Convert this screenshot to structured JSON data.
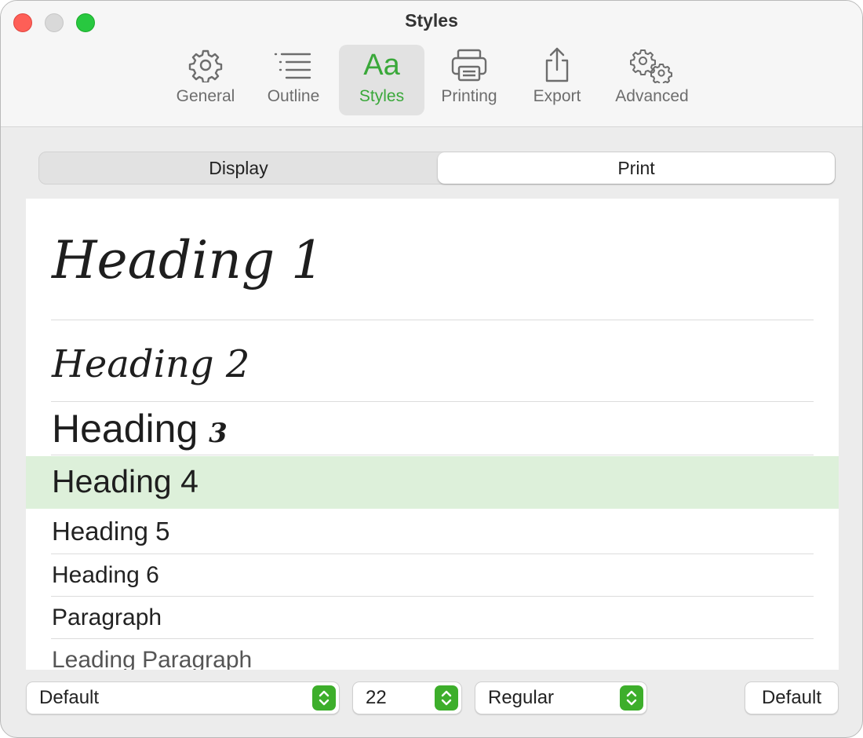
{
  "window": {
    "title": "Styles"
  },
  "toolbar": {
    "items": [
      {
        "label": "General",
        "icon": "gear-icon"
      },
      {
        "label": "Outline",
        "icon": "list-icon"
      },
      {
        "label": "Styles",
        "icon": "aa-icon",
        "glyph": "Aa"
      },
      {
        "label": "Printing",
        "icon": "printer-icon"
      },
      {
        "label": "Export",
        "icon": "share-icon"
      },
      {
        "label": "Advanced",
        "icon": "gears-icon"
      }
    ],
    "active": "Styles",
    "accent_color": "#3aa83a"
  },
  "segments": {
    "items": [
      "Display",
      "Print"
    ],
    "selected": "Print"
  },
  "styles_list": {
    "items": [
      {
        "label": "Heading 1"
      },
      {
        "label": "Heading 2"
      },
      {
        "label": "Heading",
        "suffix": "3"
      },
      {
        "label": "Heading 4"
      },
      {
        "label": "Heading 5"
      },
      {
        "label": "Heading 6"
      },
      {
        "label": "Paragraph"
      },
      {
        "label": "Leading Paragraph"
      }
    ],
    "selected": "Heading 4",
    "selected_color": "#ddf0da"
  },
  "footer": {
    "font_popup": "Default",
    "size_popup": "22",
    "weight_popup": "Regular",
    "default_button": "Default"
  }
}
